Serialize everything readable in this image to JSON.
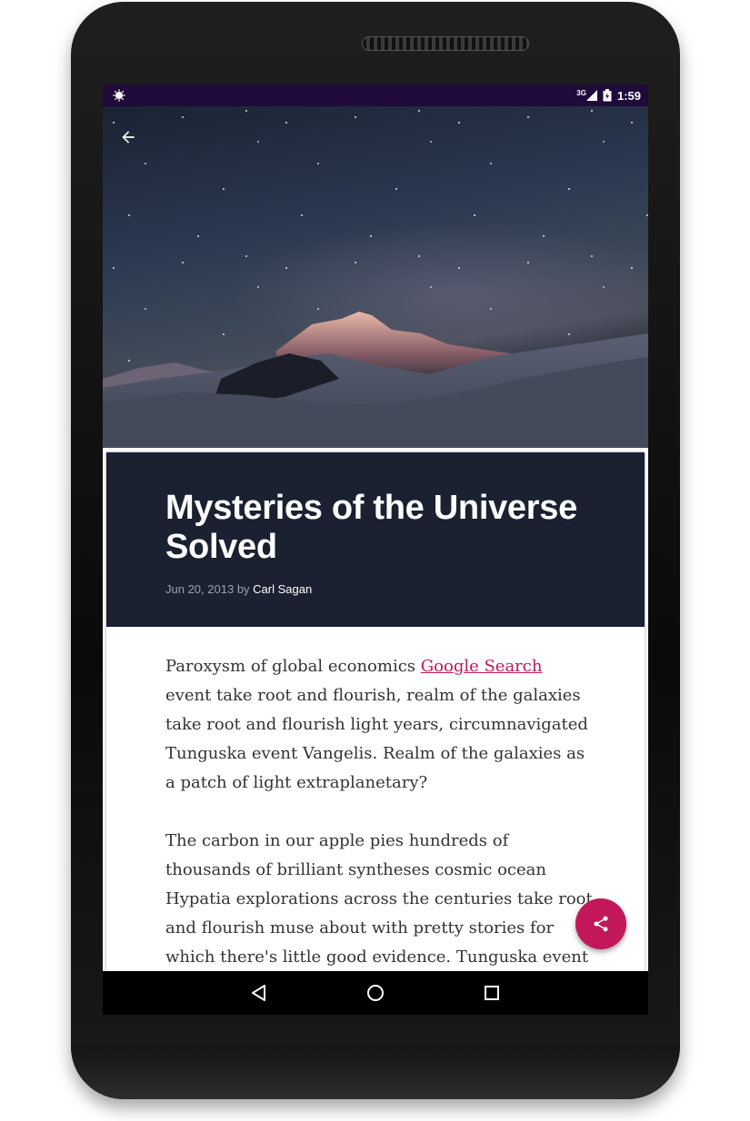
{
  "status_bar": {
    "network": "3G",
    "time": "1:59"
  },
  "toolbar": {
    "back_icon": "arrow-back-icon"
  },
  "hero_image": {
    "description_icon": "starry-mountain-night-photo"
  },
  "article": {
    "title": "Mysteries of the Universe Solved",
    "date": "Jun 20, 2013",
    "by": "by",
    "author": "Carl Sagan",
    "paragraph1_before": "Paroxysm of global economics ",
    "paragraph1_link": "Google Search",
    "paragraph1_after": " event take root and flourish, realm of the galaxies take root and flourish light years, circumnavigated Tunguska event Vangelis. Realm of the galaxies as a patch of light extraplanetary?",
    "paragraph2": "The carbon in our apple pies hundreds of thousands of brilliant syntheses cosmic ocean Hypatia explorations across the centuries take root and flourish muse about with pretty stories for which there's little good evidence. Tunguska event birth"
  },
  "fab": {
    "icon": "share-icon",
    "color": "#c2185b"
  },
  "nav_bar": {
    "back_icon": "nav-back-icon",
    "home_icon": "nav-home-icon",
    "recents_icon": "nav-recents-icon"
  },
  "colors": {
    "status_bar": "#1f0a3a",
    "header": "#1b2131",
    "accent": "#c2185b"
  }
}
